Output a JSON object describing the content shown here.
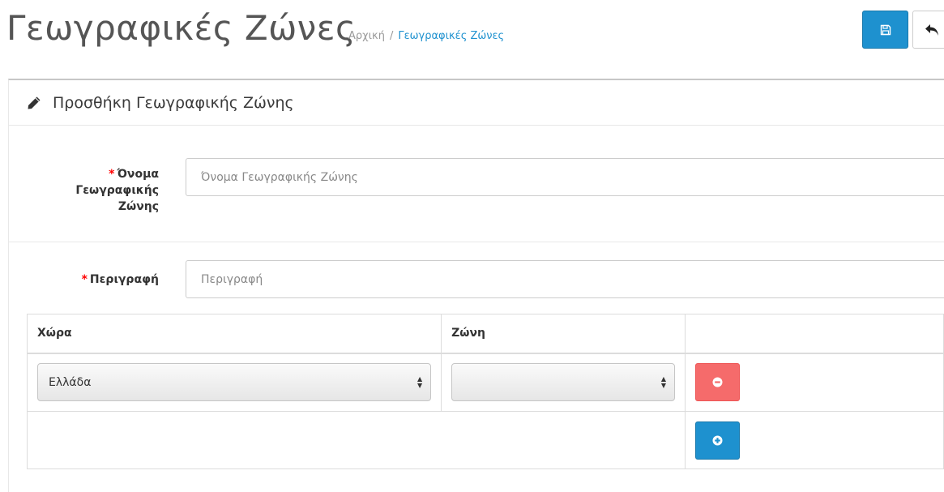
{
  "header": {
    "title": "Γεωγραφικές Ζώνες",
    "breadcrumb": {
      "home": "Αρχική",
      "separator": "/",
      "current": "Γεωγραφικές Ζώνες"
    },
    "save_icon": "floppy-disk-icon",
    "back_icon": "reply-arrow-icon"
  },
  "panel": {
    "icon": "pencil-icon",
    "heading": "Προσθήκη Γεωγραφικής Ζώνης"
  },
  "form": {
    "required_marker": "*",
    "name_label_line1": "Όνομα",
    "name_label_line2": "Γεωγραφικής",
    "name_label_line3": "Ζώνης",
    "name_placeholder": "Όνομα Γεωγραφικής Ζώνης",
    "name_value": "",
    "description_label": "Περιγραφή",
    "description_placeholder": "Περιγραφή",
    "description_value": ""
  },
  "zone_table": {
    "columns": [
      "Χώρα",
      "Ζώνη",
      ""
    ],
    "rows": [
      {
        "country": "Ελλάδα",
        "zone": ""
      }
    ],
    "remove_icon": "minus-circle-icon",
    "add_icon": "plus-circle-icon"
  },
  "colors": {
    "primary": "#1e91cf",
    "danger": "#f56b6b",
    "required": "#ff0000",
    "breadcrumb_link": "#1e91cf"
  }
}
